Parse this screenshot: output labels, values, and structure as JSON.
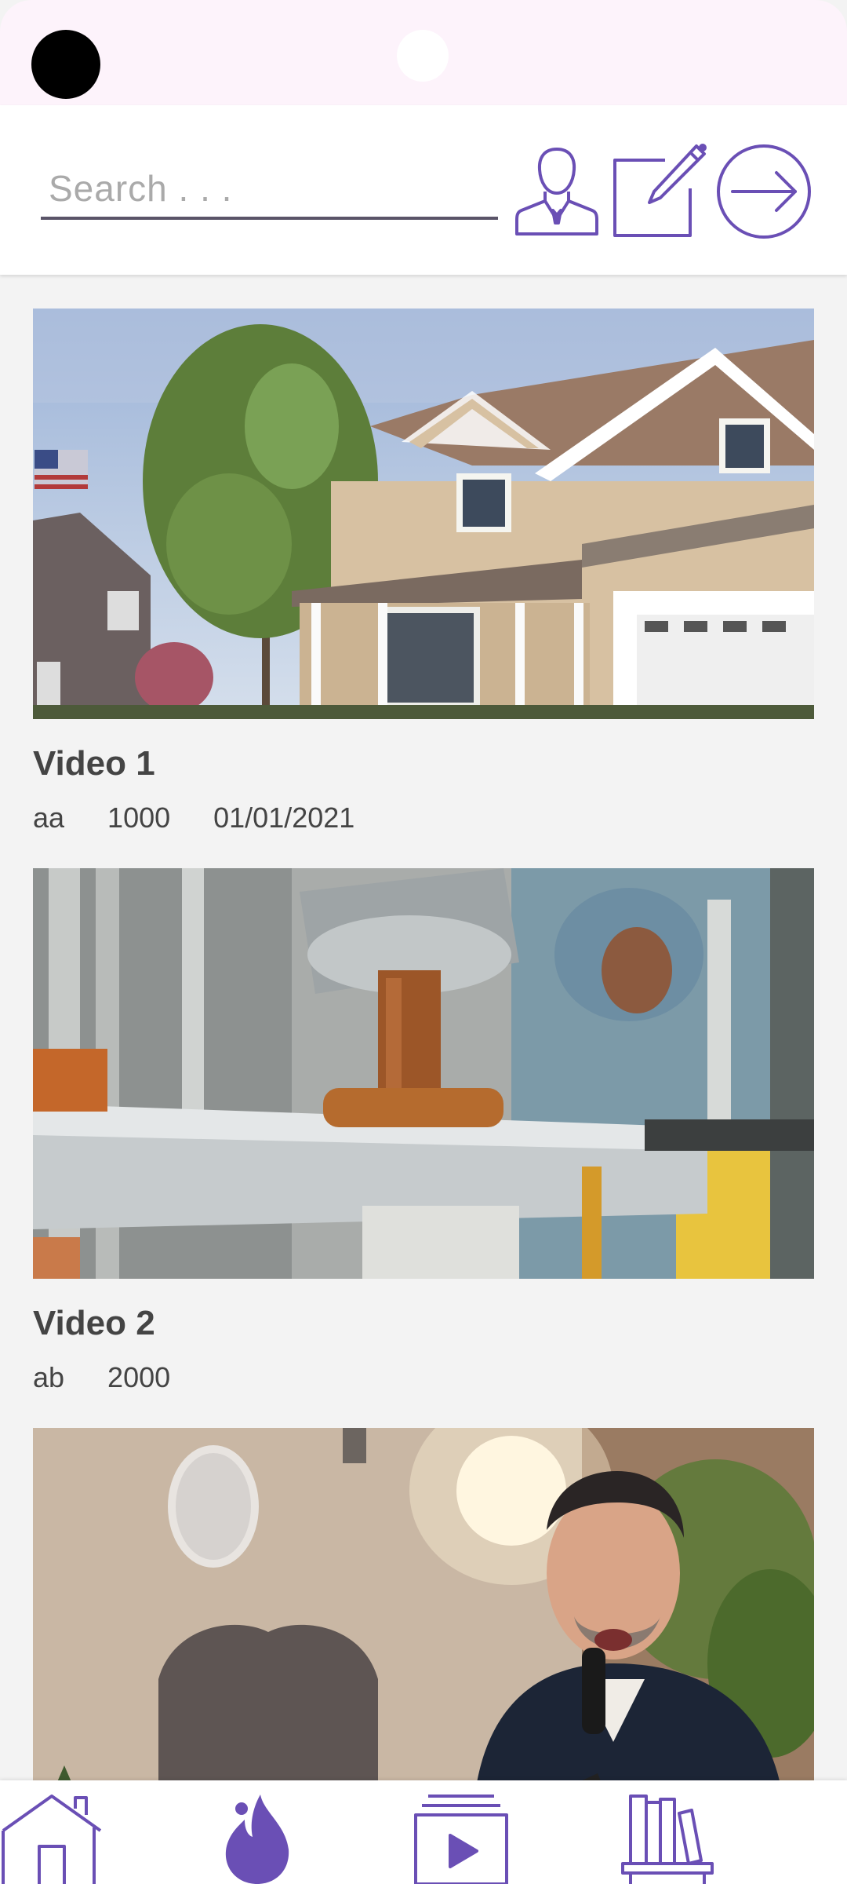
{
  "search": {
    "placeholder": "Search . . ."
  },
  "colors": {
    "accent": "#6a4fb5",
    "background": "#f3f3f3"
  },
  "header_icons": [
    "user-icon",
    "edit-icon",
    "logout-icon"
  ],
  "videos": [
    {
      "title": "Video 1",
      "author": "aa",
      "views": "1000",
      "date": "01/01/2021",
      "thumbnail": "house-thumbnail"
    },
    {
      "title": "Video 2",
      "author": "ab",
      "views": "2000",
      "date": "",
      "thumbnail": "factory-thumbnail"
    },
    {
      "title": "",
      "author": "",
      "views": "",
      "date": "",
      "thumbnail": "singer-thumbnail"
    }
  ],
  "bottom_nav": [
    "home-icon",
    "trending-fire-icon",
    "videos-play-icon",
    "library-icon"
  ]
}
